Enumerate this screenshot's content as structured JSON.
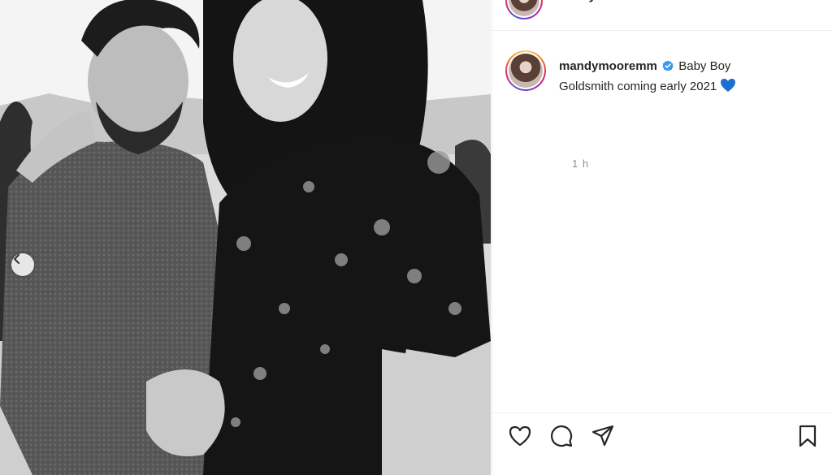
{
  "post": {
    "header_username": "mandymooremm",
    "caption": {
      "username": "mandymooremm",
      "text_line1": "Baby Boy",
      "text_line2": "Goldsmith coming early 2021",
      "emoji": "blue-heart"
    },
    "timestamp": "1 h"
  },
  "icons": {
    "verified": "verified-badge-icon",
    "carousel_prev": "chevron-left-icon",
    "like": "heart-outline-icon",
    "comment": "comment-bubble-icon",
    "share": "paper-plane-icon",
    "save": "bookmark-icon"
  },
  "colors": {
    "verified_blue": "#3897f0",
    "emoji_heart": "#1c6fd1",
    "text": "#262626",
    "muted": "#8e8e8e",
    "divider": "#efefef"
  }
}
